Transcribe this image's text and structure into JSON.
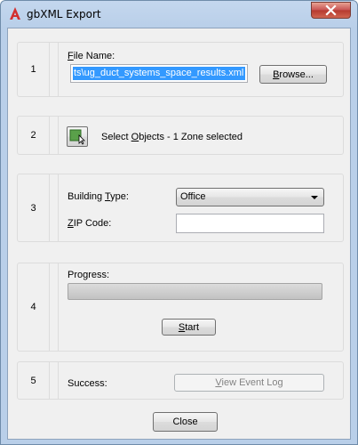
{
  "window": {
    "title": "gbXML Export",
    "accent_color": "#c75050"
  },
  "step1": {
    "number": "1",
    "file_label_prefix": "",
    "file_label_ul": "F",
    "file_label_rest": "ile Name:",
    "file_value": "ts\\ug_duct_systems_space_results.xml",
    "browse_ul": "B",
    "browse_rest": "rowse..."
  },
  "step2": {
    "number": "2",
    "select_prefix": "Select ",
    "select_ul": "O",
    "select_rest": "bjects - 1 Zone selected",
    "icon": "select-objects-icon"
  },
  "step3": {
    "number": "3",
    "building_label_prefix": "Building ",
    "building_label_ul": "T",
    "building_label_rest": "ype:",
    "building_value": "Office",
    "zip_label_ul": "Z",
    "zip_label_rest": "IP Code:",
    "zip_value": ""
  },
  "step4": {
    "number": "4",
    "progress_label": "Progress:",
    "progress_fraction": 0,
    "start_ul": "S",
    "start_rest": "tart"
  },
  "step5": {
    "number": "5",
    "success_label": "Success:",
    "view_log_ul": "V",
    "view_log_rest": "iew Event Log"
  },
  "footer": {
    "close_label": "Close"
  }
}
